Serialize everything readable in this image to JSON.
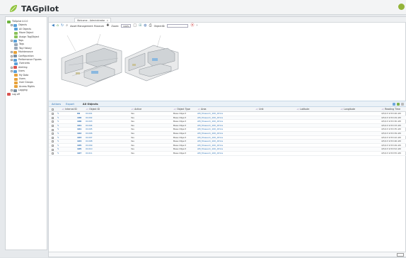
{
  "app": {
    "brand": "TAGpilot"
  },
  "tab": {
    "label": "Welcome - Administrator",
    "close": "×"
  },
  "toolbar": {
    "breadcrumb": "Asset Management Museum",
    "zoom_label": "Zoom:",
    "zoom_value": "100%",
    "objectid_label": "ObjectID:"
  },
  "sidebar": {
    "items": [
      {
        "label": "TAGpilot 4.0.0",
        "level": 0,
        "icon": "#6cb33e"
      },
      {
        "label": "Objects",
        "level": 1,
        "icon": "#5aa0d8"
      },
      {
        "label": "All Objects",
        "level": 2,
        "icon": "#5aa0d8"
      },
      {
        "label": "Move Object",
        "level": 2,
        "icon": "#8ac25a"
      },
      {
        "label": "Assign Tag/Object",
        "level": 2,
        "icon": "#8ac25a"
      },
      {
        "label": "Tags",
        "level": 1,
        "icon": "#5aa0d8"
      },
      {
        "label": "Tags",
        "level": 2,
        "icon": "#9aa8b6"
      },
      {
        "label": "Tag History",
        "level": 2,
        "icon": "#9aa8b6"
      },
      {
        "label": "Maintenance",
        "level": 1,
        "icon": "#e8a23a"
      },
      {
        "label": "Configuration",
        "level": 1,
        "icon": "#7a8ea0"
      },
      {
        "label": "Performance Figures",
        "level": 1,
        "icon": "#5aa0d8"
      },
      {
        "label": "Overview",
        "level": 2,
        "icon": "#5aa0d8"
      },
      {
        "label": "Alerting",
        "level": 1,
        "icon": "#d9534f"
      },
      {
        "label": "Users",
        "level": 1,
        "icon": "#5aa0d8"
      },
      {
        "label": "My Data",
        "level": 2,
        "icon": "#e8a23a"
      },
      {
        "label": "Users",
        "level": 2,
        "icon": "#e8a23a"
      },
      {
        "label": "User Groups",
        "level": 2,
        "icon": "#e8a23a"
      },
      {
        "label": "Access Rights",
        "level": 2,
        "icon": "#e8a23a"
      },
      {
        "label": "Logging",
        "level": 1,
        "icon": "#7a8ea0"
      },
      {
        "label": "Log off",
        "level": 0,
        "icon": "#d9534f"
      }
    ]
  },
  "grid": {
    "actions_label": "Actions",
    "export_label": "Export",
    "title": "All Objects",
    "columns": [
      "Internal ID",
      "Object ID",
      "Active",
      "Object Type",
      "Area",
      "Unit",
      "Latitude",
      "Longitude",
      "Reading Time"
    ],
    "rows": [
      {
        "internal": "99",
        "object": "01001",
        "active": "Yes",
        "type": "Base Object",
        "area": "AM_Museum_100_Africa",
        "time": "4/5/13 9:53:26 AM"
      },
      {
        "internal": "100",
        "object": "01002",
        "active": "Yes",
        "type": "Base Object",
        "area": "AM_Museum_100_Africa",
        "time": "4/5/13 9:53:29 AM"
      },
      {
        "internal": "100",
        "object": "01003",
        "active": "Yes",
        "type": "Base Object",
        "area": "AM_Museum_100_Africa",
        "time": "4/5/13 9:53:30 AM"
      },
      {
        "internal": "101",
        "object": "01004",
        "active": "Yes",
        "type": "Base Object",
        "area": "AM_Museum_100_Africa",
        "time": "4/5/13 9:53:33 AM"
      },
      {
        "internal": "101",
        "object": "01005",
        "active": "Yes",
        "type": "Base Object",
        "area": "AM_Museum_100_Africa",
        "time": "4/5/13 9:53:35 AM"
      },
      {
        "internal": "102",
        "object": "01006",
        "active": "Yes",
        "type": "Base Object",
        "area": "AM_Museum_100_Africa",
        "time": "4/5/13 9:53:39 AM"
      },
      {
        "internal": "103",
        "object": "01007",
        "active": "Yes",
        "type": "Base Object",
        "area": "AM_Museum_100_Africa",
        "time": "4/5/13 9:53:42 AM"
      },
      {
        "internal": "104",
        "object": "01008",
        "active": "Yes",
        "type": "Base Object",
        "area": "AM_Museum_100_Africa",
        "time": "4/5/13 9:53:46 AM"
      },
      {
        "internal": "105",
        "object": "01009",
        "active": "Yes",
        "type": "Base Object",
        "area": "AM_Museum_100_Africa",
        "time": "4/5/13 9:53:49 AM"
      },
      {
        "internal": "105",
        "object": "01010",
        "active": "Yes",
        "type": "Base Object",
        "area": "AM_Museum_100_Africa",
        "time": "4/5/13 9:53:52 AM"
      },
      {
        "internal": "107",
        "object": "01011",
        "active": "Yes",
        "type": "Base Object",
        "area": "AM_Museum_100_Africa",
        "time": "4/5/13 9:53:55 AM"
      }
    ]
  }
}
